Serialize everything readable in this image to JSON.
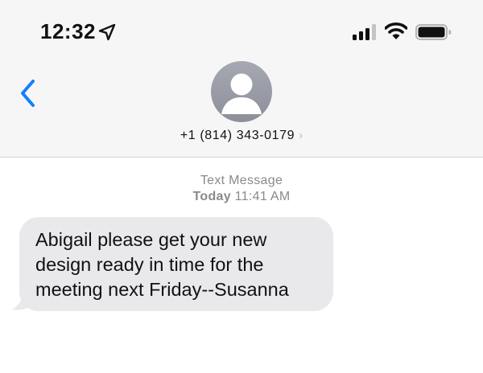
{
  "status_bar": {
    "time": "12:32",
    "icons": [
      "location-arrow-icon",
      "cellular-signal-icon",
      "wifi-icon",
      "battery-icon"
    ]
  },
  "nav": {
    "back_icon": "chevron-left-icon",
    "avatar_icon": "person-silhouette-icon",
    "contact_number": "+1 (814) 343-0179",
    "contact_chevron": "›"
  },
  "conversation": {
    "service_label": "Text Message",
    "day": "Today",
    "time": "11:41 AM",
    "messages": [
      {
        "direction": "incoming",
        "lines": [
          "Abigail please get your new",
          "design ready in time for the",
          "meeting next Friday--Susanna"
        ]
      }
    ]
  },
  "colors": {
    "accent": "#147efb",
    "header_background": "#f6f6f6",
    "incoming_bubble": "#e9e9eb",
    "meta_text": "#8a8a8e",
    "avatar": "#9a9da6"
  }
}
